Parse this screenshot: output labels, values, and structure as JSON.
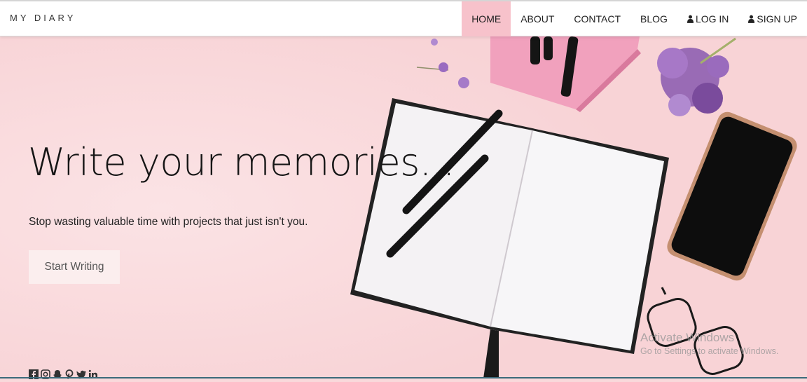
{
  "brand": "MY DIARY",
  "nav": {
    "home": "HOME",
    "about": "ABOUT",
    "contact": "CONTACT",
    "blog": "BLOG",
    "login": "LOG IN",
    "signup": "SIGN UP"
  },
  "hero": {
    "title": "Write your memories...",
    "subtitle": "Stop wasting valuable time with projects that just isn't you.",
    "cta": "Start Writing"
  },
  "social": [
    "facebook-icon",
    "instagram-icon",
    "snapchat-icon",
    "pinterest-icon",
    "twitter-icon",
    "linkedin-icon"
  ],
  "watermark": {
    "line1": "Activate Windows",
    "line2": "Go to Settings to activate Windows."
  },
  "colors": {
    "background": "#f9d9db",
    "nav_active": "#f7c2cb",
    "button_bg": "#fbeeee"
  }
}
